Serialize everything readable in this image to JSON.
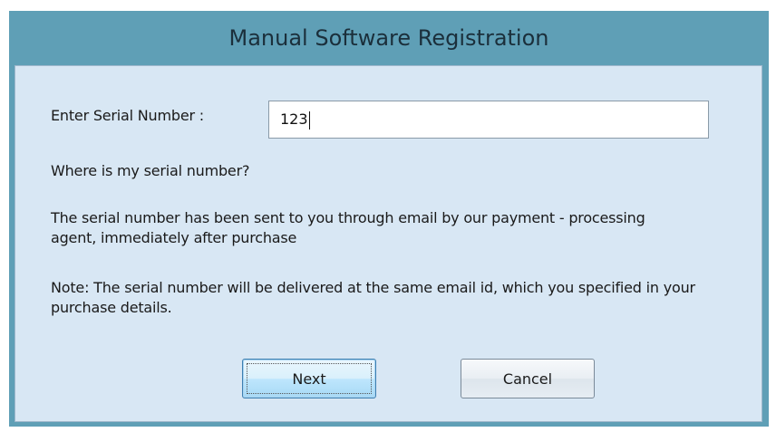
{
  "dialog": {
    "title": "Manual Software Registration"
  },
  "serial": {
    "label": "Enter Serial Number :",
    "value": "123"
  },
  "help": {
    "question": "Where is my serial number?",
    "answer": "The serial number has been sent to you through email by our payment - processing agent, immediately after purchase",
    "note": "Note: The serial number will be delivered at the same email id, which you specified in your purchase details."
  },
  "buttons": {
    "next_label": "Next",
    "cancel_label": "Cancel"
  },
  "colors": {
    "title_bar": "#5f9fb6",
    "panel": "#d8e7f4"
  }
}
